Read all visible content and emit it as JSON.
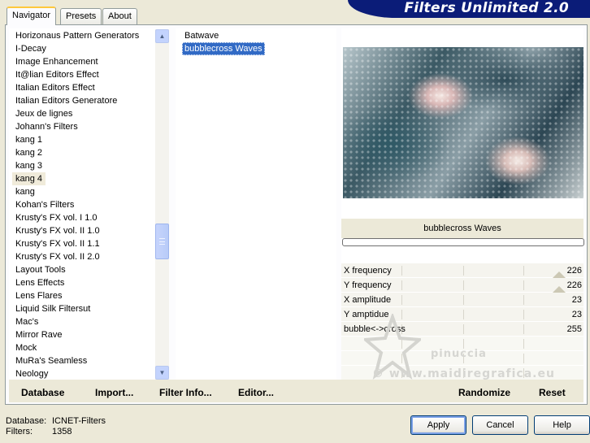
{
  "tabs": [
    "Navigator",
    "Presets",
    "About"
  ],
  "banner_title": "Filters Unlimited 2.0",
  "categories": {
    "items": [
      "Horizonaus Pattern Generators",
      "I-Decay",
      "Image Enhancement",
      "It@lian Editors Effect",
      "Italian Editors Effect",
      "Italian Editors Generatore",
      "Jeux de lignes",
      "Johann's Filters",
      "kang 1",
      "kang 2",
      "kang 3",
      "kang 4",
      "kang",
      "Kohan's Filters",
      "Krusty's FX vol. I 1.0",
      "Krusty's FX vol. II 1.0",
      "Krusty's FX vol. II 1.1",
      "Krusty's FX vol. II 2.0",
      "Layout Tools",
      "Lens Effects",
      "Lens Flares",
      "Liquid Silk Filtersut",
      "Mac's",
      "Mirror Rave",
      "Mock",
      "MuRa's Seamless",
      "Neology"
    ],
    "selected": "kang 4"
  },
  "filters": {
    "items": [
      "Batwave",
      "bubblecross Waves"
    ],
    "selected": "bubblecross Waves"
  },
  "selected_filter_title": "bubblecross Waves",
  "parameters": [
    {
      "label": "X frequency",
      "value": "226"
    },
    {
      "label": "Y frequency",
      "value": "226"
    },
    {
      "label": "X amplitude",
      "value": "23"
    },
    {
      "label": "Y amptidue",
      "value": "23"
    },
    {
      "label": "bubble<->cross",
      "value": "255"
    }
  ],
  "watermark": {
    "name": "pinuccia",
    "site": "© www.maidiregrafica.eu"
  },
  "panel_buttons": {
    "database": "Database",
    "import": "Import...",
    "filter_info": "Filter Info...",
    "editor": "Editor...",
    "randomize": "Randomize",
    "reset": "Reset"
  },
  "status": {
    "database_label": "Database:",
    "database_value": "ICNET-Filters",
    "filters_label": "Filters:",
    "filters_value": "1358"
  },
  "dialog_buttons": {
    "apply": "Apply",
    "cancel": "Cancel",
    "help": "Help"
  }
}
